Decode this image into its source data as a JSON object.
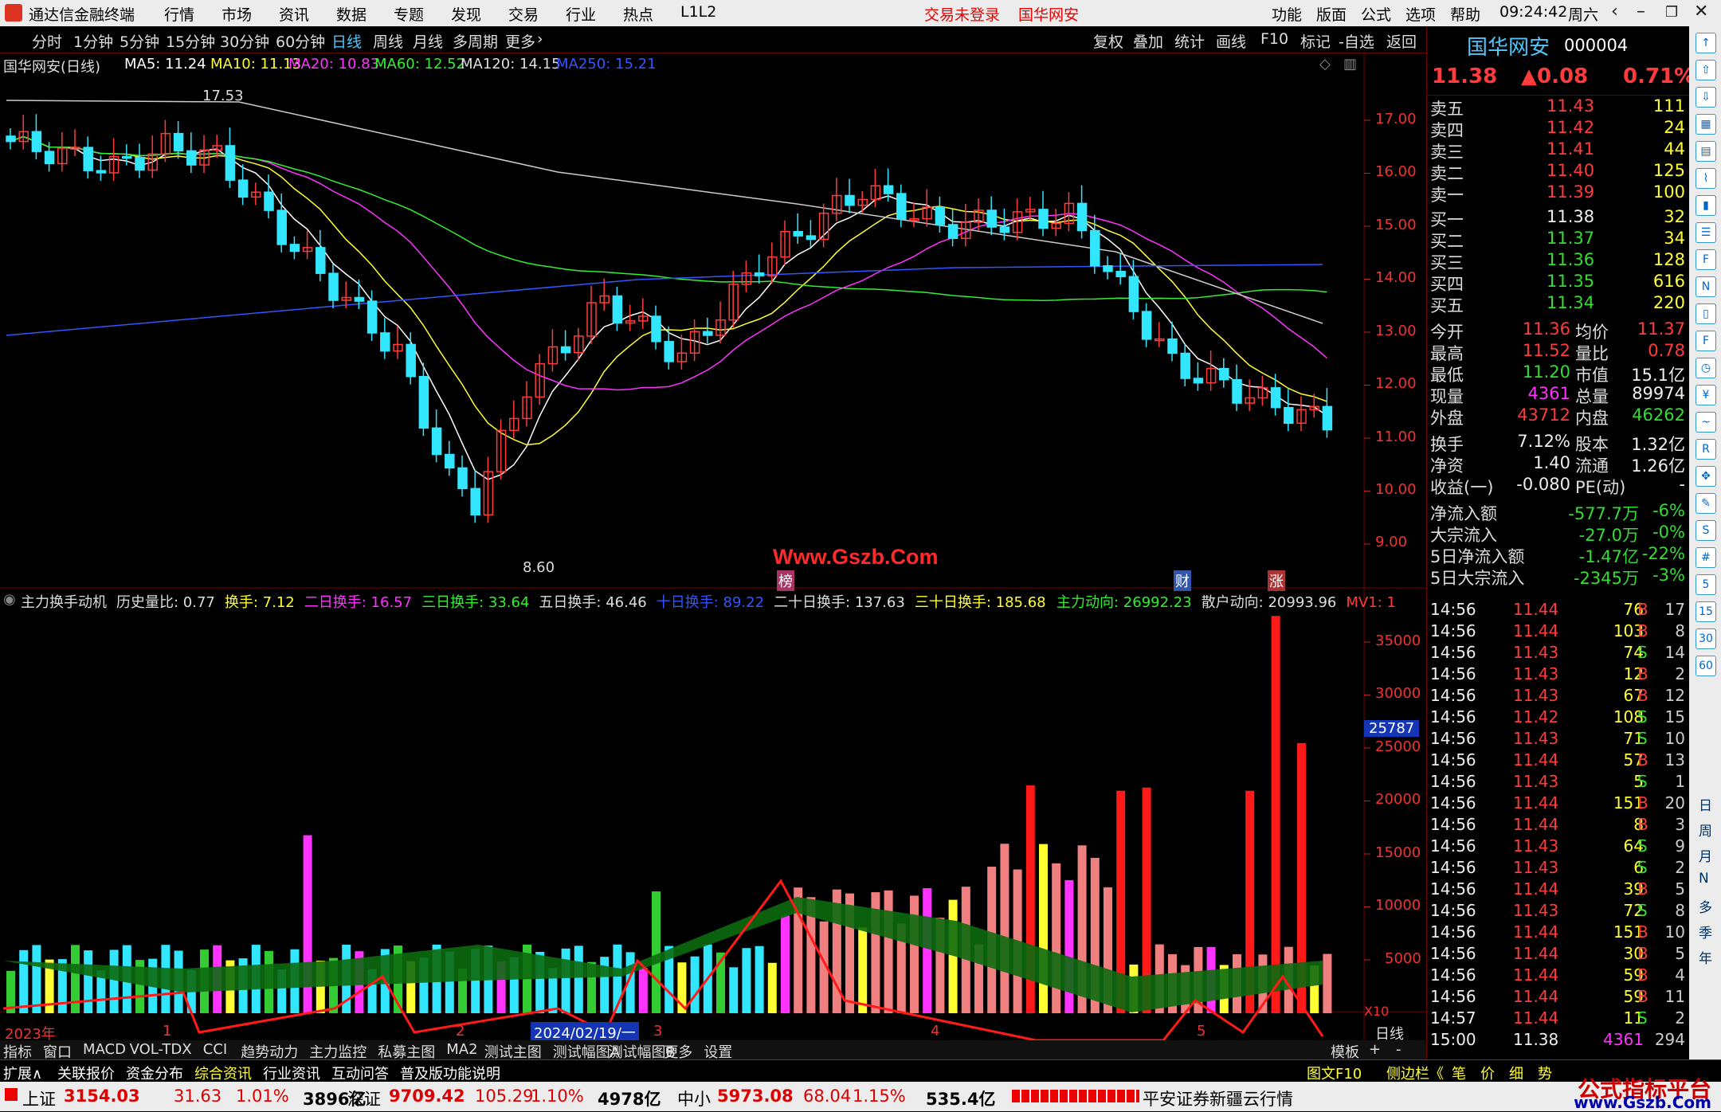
{
  "app": {
    "title": "通达信金融终端",
    "menus": [
      "行情",
      "市场",
      "资讯",
      "数据",
      "专题",
      "发现",
      "交易",
      "行业",
      "热点",
      "L1L2"
    ],
    "notice_login": "交易未登录",
    "notice_stock": "国华网安",
    "right_menus": [
      "功能",
      "版面",
      "公式",
      "选项",
      "帮助"
    ],
    "time": "09:24:42",
    "weekday": "周六"
  },
  "periods": [
    "分时",
    "1分钟",
    "5分钟",
    "15分钟",
    "30分钟",
    "60分钟",
    "日线",
    "周线",
    "月线",
    "多周期",
    "更多"
  ],
  "active_period": "日线",
  "toolbar": [
    "复权",
    "叠加",
    "统计",
    "画线",
    "F10",
    "标记",
    "-自选",
    "返回"
  ],
  "main_chart": {
    "name": "国华网安(日线)",
    "ma": [
      {
        "label": "MA5: 11.24",
        "color": "#ffffff"
      },
      {
        "label": "MA10: 11.13",
        "color": "#ffff33"
      },
      {
        "label": "MA20: 10.83",
        "color": "#ff33ff"
      },
      {
        "label": "MA60: 12.52",
        "color": "#33ee33"
      },
      {
        "label": "MA120: 14.15",
        "color": "#dddddd"
      },
      {
        "label": "MA250: 15.21",
        "color": "#3355ff"
      }
    ],
    "high_label": "17.53",
    "low_label": "8.60",
    "price_ticks": [
      "17.00",
      "16.00",
      "15.00",
      "14.00",
      "13.00",
      "12.00",
      "11.00",
      "10.00",
      "9.00"
    ],
    "markers": {
      "bang": "榜",
      "cai": "财",
      "zhang": "涨"
    },
    "watermark": "Www.Gszb.Com"
  },
  "sub_chart": {
    "legend": [
      {
        "t": "主力换手动机",
        "c": "#dddddd"
      },
      {
        "t": "历史量比: 0.77",
        "c": "#dddddd"
      },
      {
        "t": "换手: 7.12",
        "c": "#ffff33"
      },
      {
        "t": "二日换手: 16.57",
        "c": "#ff33ff"
      },
      {
        "t": "三日换手: 33.64",
        "c": "#33ee33"
      },
      {
        "t": "五日换手: 46.46",
        "c": "#dddddd"
      },
      {
        "t": "十日换手: 89.22",
        "c": "#3355ff"
      },
      {
        "t": "二十日换手: 137.63",
        "c": "#dddddd"
      },
      {
        "t": "三十日换手: 185.68",
        "c": "#ffff33"
      }
    ],
    "legend_right": [
      {
        "t": "主力动向: 26992.23",
        "c": "#33ee33"
      },
      {
        "t": "散户动向: 20993.96",
        "c": "#dddddd"
      },
      {
        "t": "MV1: 1",
        "c": "#ff3b3b"
      }
    ],
    "ticks": [
      "35000",
      "30000",
      "25000",
      "20000",
      "15000",
      "10000",
      "5000"
    ],
    "cursor_value": "25787",
    "unit": "X10"
  },
  "time_axis": {
    "labels": [
      "2023年",
      "1",
      "2",
      "3",
      "4",
      "5"
    ],
    "highlight": "2024/02/19/一",
    "right": "日线"
  },
  "quote": {
    "name": "国华网安",
    "code": "000004",
    "price": "11.38",
    "change": "▲0.08",
    "pct": "0.71%",
    "sells": [
      [
        "卖五",
        "11.43",
        "111"
      ],
      [
        "卖四",
        "11.42",
        "24"
      ],
      [
        "卖三",
        "11.41",
        "44"
      ],
      [
        "卖二",
        "11.40",
        "125"
      ],
      [
        "卖一",
        "11.39",
        "100"
      ]
    ],
    "buys": [
      [
        "买一",
        "11.38",
        "32"
      ],
      [
        "买二",
        "11.37",
        "34"
      ],
      [
        "买三",
        "11.36",
        "128"
      ],
      [
        "买四",
        "11.35",
        "616"
      ],
      [
        "买五",
        "11.34",
        "220"
      ]
    ],
    "stats": [
      [
        "今开",
        "11.36",
        "均价",
        "11.37"
      ],
      [
        "最高",
        "11.52",
        "量比",
        "0.78"
      ],
      [
        "最低",
        "11.20",
        "市值",
        "15.1亿"
      ],
      [
        "现量",
        "4361",
        "总量",
        "89974"
      ],
      [
        "外盘",
        "43712",
        "内盘",
        "46262"
      ]
    ],
    "stats2": [
      [
        "换手",
        "7.12%",
        "股本",
        "1.32亿"
      ],
      [
        "净资",
        "1.40",
        "流通",
        "1.26亿"
      ],
      [
        "收益(一)",
        "-0.080",
        "PE(动)",
        "-"
      ]
    ],
    "flows": [
      [
        "净流入额",
        "-577.7万",
        "-6%"
      ],
      [
        "大宗流入",
        "-27.0万",
        "-0%"
      ],
      [
        "5日净流入额",
        "-1.47亿",
        "-22%"
      ],
      [
        "5日大宗流入",
        "-2345万",
        "-3%"
      ]
    ],
    "ticks": [
      [
        "14:56",
        "11.44",
        "76",
        "B",
        "17"
      ],
      [
        "14:56",
        "11.44",
        "103",
        "B",
        "8"
      ],
      [
        "14:56",
        "11.43",
        "74",
        "S",
        "14"
      ],
      [
        "14:56",
        "11.43",
        "12",
        "B",
        "2"
      ],
      [
        "14:56",
        "11.43",
        "67",
        "B",
        "12"
      ],
      [
        "14:56",
        "11.42",
        "108",
        "S",
        "15"
      ],
      [
        "14:56",
        "11.43",
        "71",
        "S",
        "10"
      ],
      [
        "14:56",
        "11.44",
        "57",
        "B",
        "13"
      ],
      [
        "14:56",
        "11.43",
        "5",
        "S",
        "1"
      ],
      [
        "14:56",
        "11.44",
        "151",
        "B",
        "20"
      ],
      [
        "14:56",
        "11.44",
        "8",
        "B",
        "3"
      ],
      [
        "14:56",
        "11.43",
        "64",
        "S",
        "9"
      ],
      [
        "14:56",
        "11.43",
        "6",
        "S",
        "2"
      ],
      [
        "14:56",
        "11.44",
        "39",
        "B",
        "5"
      ],
      [
        "14:56",
        "11.43",
        "72",
        "S",
        "8"
      ],
      [
        "14:56",
        "11.44",
        "151",
        "B",
        "10"
      ],
      [
        "14:56",
        "11.44",
        "30",
        "B",
        "5"
      ],
      [
        "14:56",
        "11.44",
        "59",
        "B",
        "4"
      ],
      [
        "14:56",
        "11.44",
        "59",
        "B",
        "11"
      ],
      [
        "14:57",
        "11.44",
        "11",
        "S",
        "2"
      ],
      [
        "15:00",
        "11.38",
        "4361",
        "",
        "294"
      ]
    ]
  },
  "bottom_tabs": [
    "指标",
    "窗口",
    "MACD",
    "VOL-TDX",
    "CCI",
    "趋势动力",
    "主力监控",
    "私募主图",
    "MA2",
    "测试主图",
    "测试幅图A",
    "测试幅图B",
    "更多",
    "设置"
  ],
  "bottom_right": [
    "模板",
    "+",
    "-"
  ],
  "ext_tabs": [
    "扩展∧",
    "关联报价",
    "资金分布",
    "综合资讯",
    "行业资讯",
    "互动问答",
    "普及版功能说明"
  ],
  "ext_right": [
    "图文F10",
    "侧边栏《",
    "笔",
    "价",
    "细",
    "势"
  ],
  "status": {
    "sh": [
      "上证",
      "3154.03",
      "31.63",
      "1.01%",
      "3896亿"
    ],
    "sz": [
      "深证",
      "9709.42",
      "105.29",
      "1.10%",
      "4978亿"
    ],
    "zx": [
      "中小",
      "5973.08",
      "68.04",
      "1.15%",
      "535.4亿"
    ],
    "broker": "平安证券新疆云行情"
  },
  "watermark2": "公式指标平台",
  "watermark3": "www.Gszb.Com",
  "side_labels": [
    "日",
    "周",
    "月",
    "N",
    "多",
    "季",
    "年"
  ]
}
